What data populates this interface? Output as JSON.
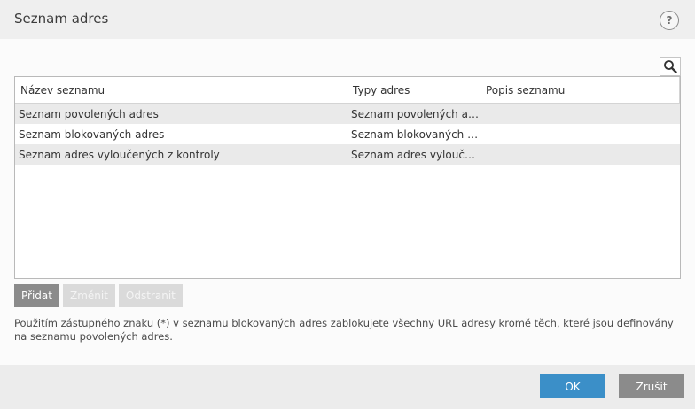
{
  "window": {
    "title": "Seznam adres",
    "help_label": "?"
  },
  "toolbar": {
    "search_icon": "search-icon"
  },
  "table": {
    "columns": [
      "Název seznamu",
      "Typy adres",
      "Popis seznamu"
    ],
    "rows": [
      [
        "Seznam povolených adres",
        "Seznam povolených adres",
        ""
      ],
      [
        "Seznam blokovaných adres",
        "Seznam blokovaných ad...",
        ""
      ],
      [
        "Seznam adres vyloučených z kontroly",
        "Seznam adres vyloučený...",
        ""
      ]
    ]
  },
  "actions": {
    "add_label": "Přidat",
    "edit_label": "Změnit",
    "remove_label": "Odstranit"
  },
  "note": {
    "text": "Použitím zástupného znaku (*) v seznamu blokovaných adres zablokujete všechny URL adresy kromě těch, které jsou definovány na seznamu povolených adres."
  },
  "footer": {
    "ok_label": "OK",
    "cancel_label": "Zrušit"
  },
  "colors": {
    "accent": "#3b8fc8",
    "button_gray": "#8b8b8b",
    "row_alt": "#eaeaea"
  }
}
